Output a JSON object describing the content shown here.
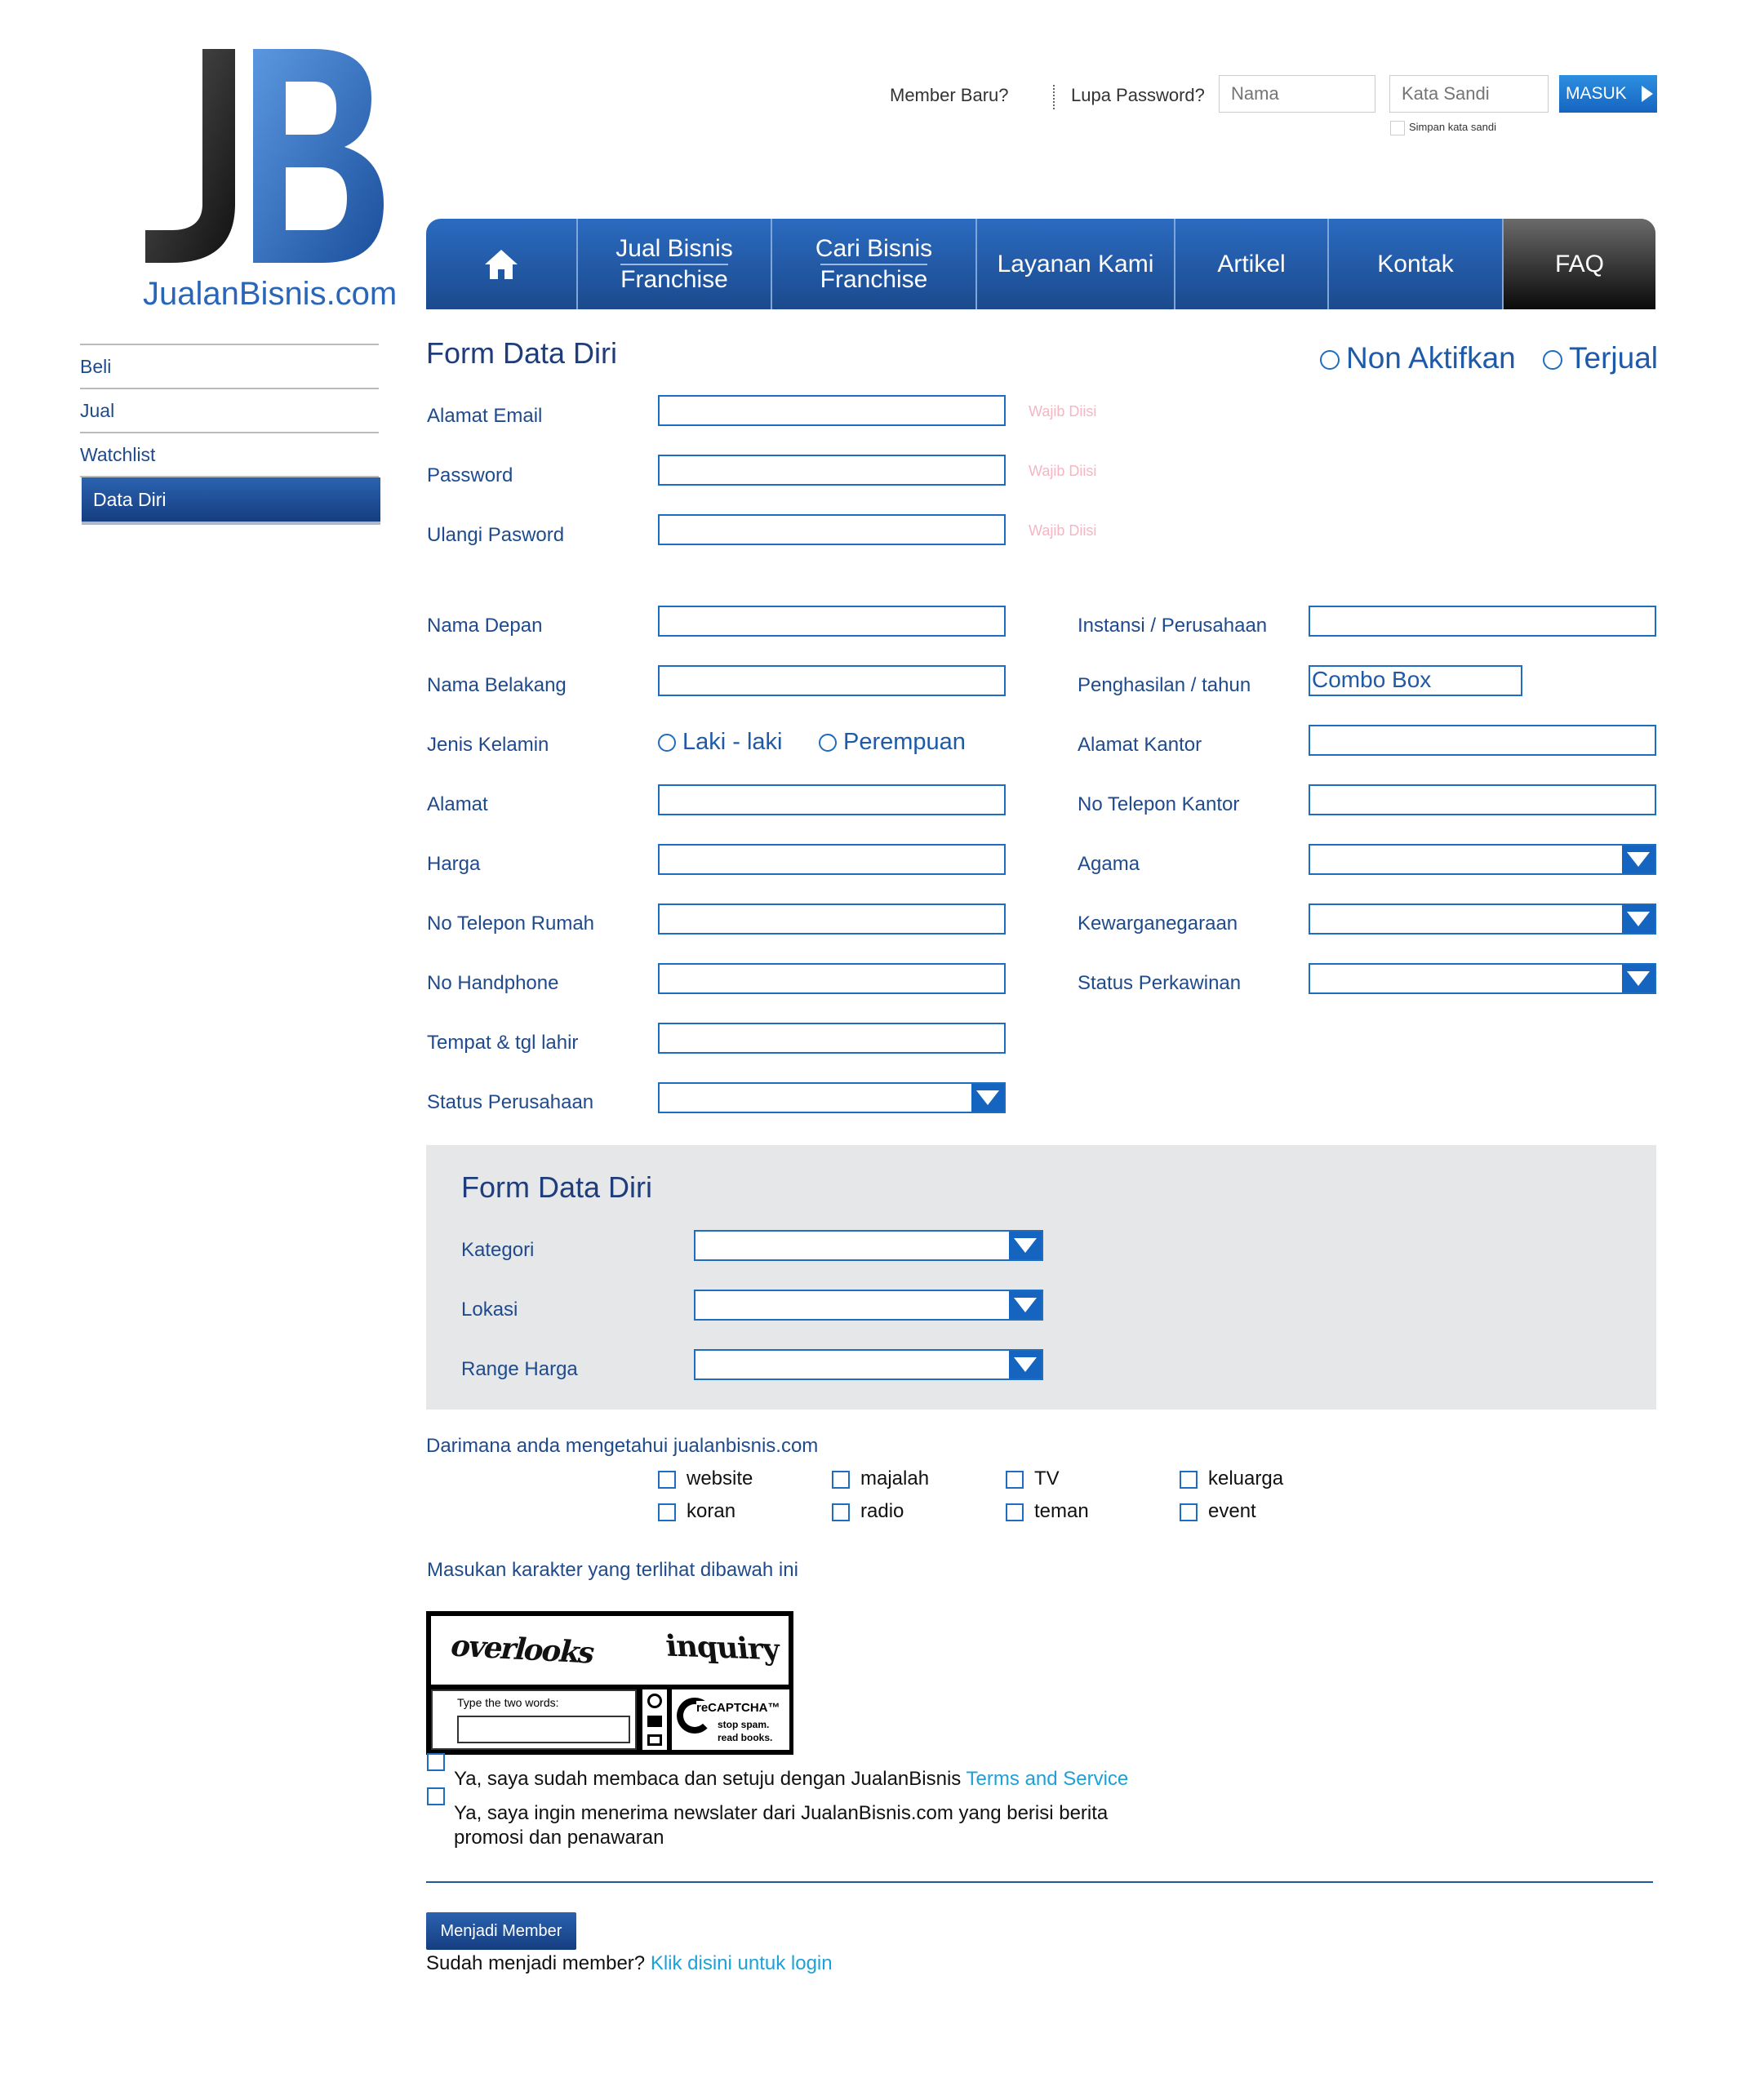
{
  "logo": {
    "letters": "JB",
    "text": "JualanBisnis.com"
  },
  "top": {
    "member_baru": "Member Baru?",
    "lupa_password": "Lupa Password?",
    "nama_placeholder": "Nama",
    "kata_sandi_placeholder": "Kata Sandi",
    "masuk_label": "MASUK",
    "simpan_label": "Simpan kata sandi"
  },
  "nav": {
    "items": [
      {
        "label": "home"
      },
      {
        "label": "Jual Bisnis",
        "sub": "Franchise"
      },
      {
        "label": "Cari Bisnis",
        "sub": "Franchise"
      },
      {
        "label": "Layanan Kami"
      },
      {
        "label": "Artikel"
      },
      {
        "label": "Kontak"
      },
      {
        "label": "FAQ"
      }
    ]
  },
  "sidebar": {
    "items": [
      {
        "label": "Beli"
      },
      {
        "label": "Jual"
      },
      {
        "label": "Watchlist"
      },
      {
        "label": "Data Diri"
      }
    ]
  },
  "form": {
    "title": "Form Data Diri",
    "non_aktifkan": "Non Aktifkan",
    "terjual": "Terjual",
    "wajib": "Wajib Diisi",
    "alamat_email": "Alamat Email",
    "password": "Password",
    "ulangi_password": "Ulangi Pasword",
    "nama_depan": "Nama Depan",
    "nama_belakang": "Nama Belakang",
    "jenis_kelamin": "Jenis Kelamin",
    "laki": "Laki - laki",
    "perempuan": "Perempuan",
    "alamat": "Alamat",
    "harga": "Harga",
    "telp_rumah": "No Telepon Rumah",
    "handphone": "No Handphone",
    "tempat_tgl": "Tempat & tgl lahir",
    "status_perusahaan": "Status Perusahaan",
    "instansi": "Instansi / Perusahaan",
    "penghasilan": "Penghasilan / tahun",
    "combo_box": "Combo Box",
    "alamat_kantor": "Alamat Kantor",
    "telp_kantor": "No Telepon Kantor",
    "agama": "Agama",
    "kewarganegaraan": "Kewarganegaraan",
    "status_perkawinan": "Status Perkawinan"
  },
  "panel": {
    "title": "Form Data Diri",
    "kategori": "Kategori",
    "lokasi": "Lokasi",
    "range_harga": "Range Harga"
  },
  "source": {
    "question": "Darimana anda mengetahui jualanbisnis.com",
    "options": [
      "website",
      "majalah",
      "TV",
      "keluarga",
      "koran",
      "radio",
      "teman",
      "event"
    ]
  },
  "captcha": {
    "label": "Masukan karakter yang terlihat dibawah ini",
    "word1": "overlooks",
    "word2": "inquiry",
    "type_label": "Type the two words:",
    "brand": "reCAPTCHA™",
    "tagline1": "stop spam.",
    "tagline2": "read books."
  },
  "agree": {
    "terms_text": "Ya, saya sudah membaca dan setuju dengan JualanBisnis ",
    "terms_link": "Terms and Service",
    "newsletter_line1": "Ya, saya ingin menerima newslater dari JualanBisnis.com yang berisi berita",
    "newsletter_line2": "promosi dan penawaran"
  },
  "footer": {
    "button": "Menjadi Member",
    "already": "Sudah menjadi member? ",
    "login_link": "Klik disini untuk login"
  },
  "colors": {
    "primary": "#1565c0",
    "text": "#1f4a8c",
    "link": "#1da1d8",
    "panel_bg": "#e6e7e9"
  }
}
